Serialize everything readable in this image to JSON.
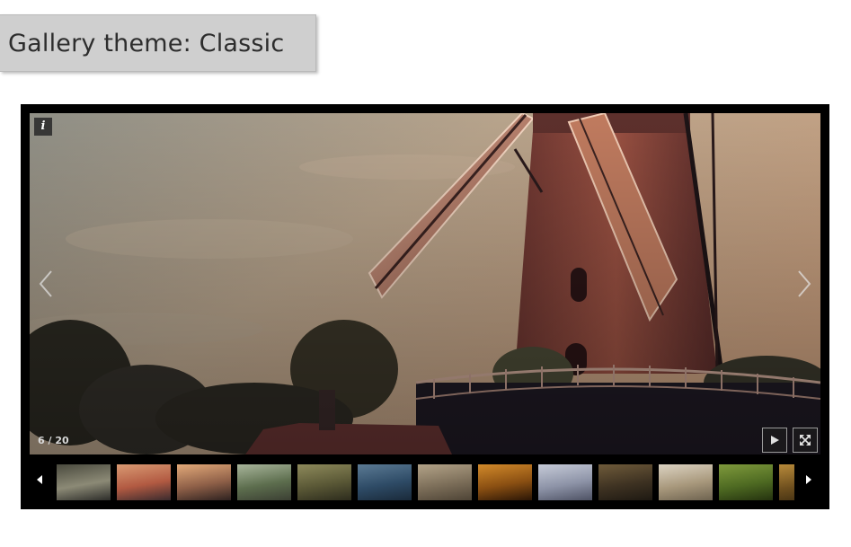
{
  "header": {
    "theme_label": "Gallery theme: Classic"
  },
  "gallery": {
    "counter": "6 / 20",
    "info_glyph": "i",
    "icons": {
      "info": "info-icon",
      "prev": "chevron-left-icon",
      "next": "chevron-right-icon",
      "play": "play-icon",
      "fullscreen": "fullscreen-icon",
      "strip_prev": "caret-left-icon",
      "strip_next": "caret-right-icon"
    },
    "thumbnails": [
      {
        "name": "thumb-street",
        "colors": [
          "#4a4a3e",
          "#8c8a76",
          "#2d2d2a"
        ]
      },
      {
        "name": "thumb-windmill",
        "colors": [
          "#d99a73",
          "#b25a42",
          "#3a2b2e"
        ]
      },
      {
        "name": "thumb-sunset-tree",
        "colors": [
          "#e2a979",
          "#8f6048",
          "#2e2220"
        ]
      },
      {
        "name": "thumb-shore",
        "colors": [
          "#a8b59b",
          "#5d6e4e",
          "#3b3f33"
        ]
      },
      {
        "name": "thumb-field-car",
        "colors": [
          "#8e8a5b",
          "#5a5836",
          "#2d2c1d"
        ]
      },
      {
        "name": "thumb-birds",
        "colors": [
          "#5b7a94",
          "#2e4b66",
          "#1a2a3a"
        ]
      },
      {
        "name": "thumb-ruins",
        "colors": [
          "#b3a388",
          "#7c6e59",
          "#4e4436"
        ]
      },
      {
        "name": "thumb-fog-orange",
        "colors": [
          "#d28a2a",
          "#8a4f12",
          "#2b1606"
        ]
      },
      {
        "name": "thumb-bridge",
        "colors": [
          "#c6cbd8",
          "#8d93a7",
          "#4e5264"
        ]
      },
      {
        "name": "thumb-dune",
        "colors": [
          "#6f5b3a",
          "#3e3222",
          "#1e1912"
        ]
      },
      {
        "name": "thumb-statue",
        "colors": [
          "#dcd3c2",
          "#a8987c",
          "#6e6350"
        ]
      },
      {
        "name": "thumb-foliage",
        "colors": [
          "#7f9a3c",
          "#4e6a22",
          "#25330f"
        ]
      },
      {
        "name": "thumb-partial",
        "colors": [
          "#b88a3a",
          "#6e4f1e",
          "#3a2a10"
        ]
      }
    ]
  }
}
